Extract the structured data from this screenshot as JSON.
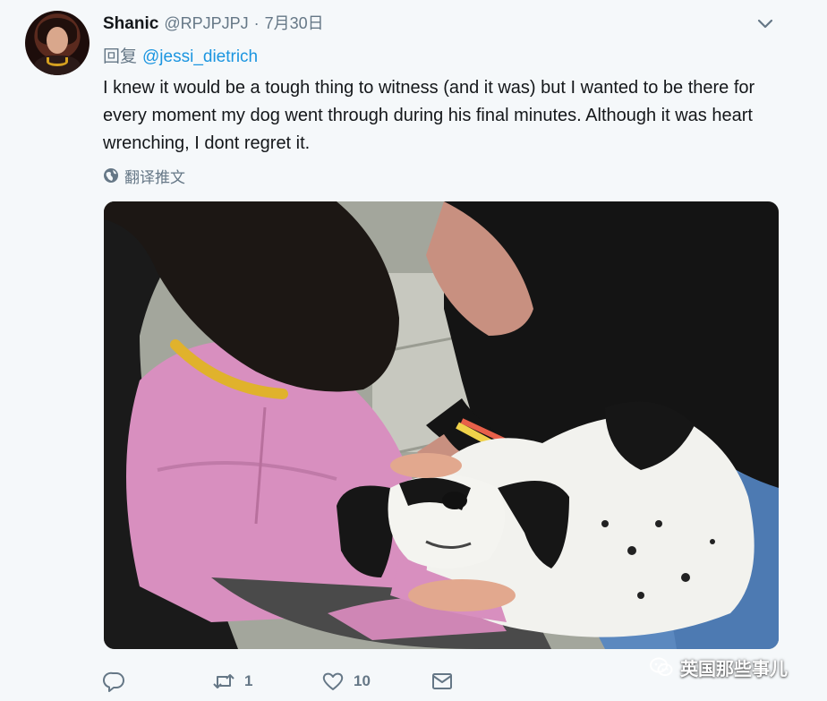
{
  "tweet": {
    "author_name": "Shanic",
    "author_handle": "@RPJPJPJ",
    "separator": "·",
    "date": "7月30日",
    "reply_prefix": "回复",
    "reply_mention": "@jessi_dietrich",
    "text": "I knew it would be a tough thing to witness (and it was) but I wanted to be there for every moment my dog went through during his final minutes. Although it was heart wrenching, I dont regret it.",
    "translate_label": "翻译推文",
    "media_icon": "photo-of-woman-and-person-comforting-dog"
  },
  "actions": {
    "reply": {
      "icon": "reply-icon"
    },
    "retweet": {
      "icon": "retweet-icon",
      "count": "1"
    },
    "like": {
      "icon": "heart-icon",
      "count": "10"
    },
    "message": {
      "icon": "envelope-icon"
    }
  },
  "watermark": {
    "text": "英国那些事儿",
    "icon": "wechat-icon"
  },
  "colors": {
    "background": "#f5f8fa",
    "link": "#1b95e0",
    "secondary_text": "#657786",
    "primary_text": "#14171a"
  }
}
